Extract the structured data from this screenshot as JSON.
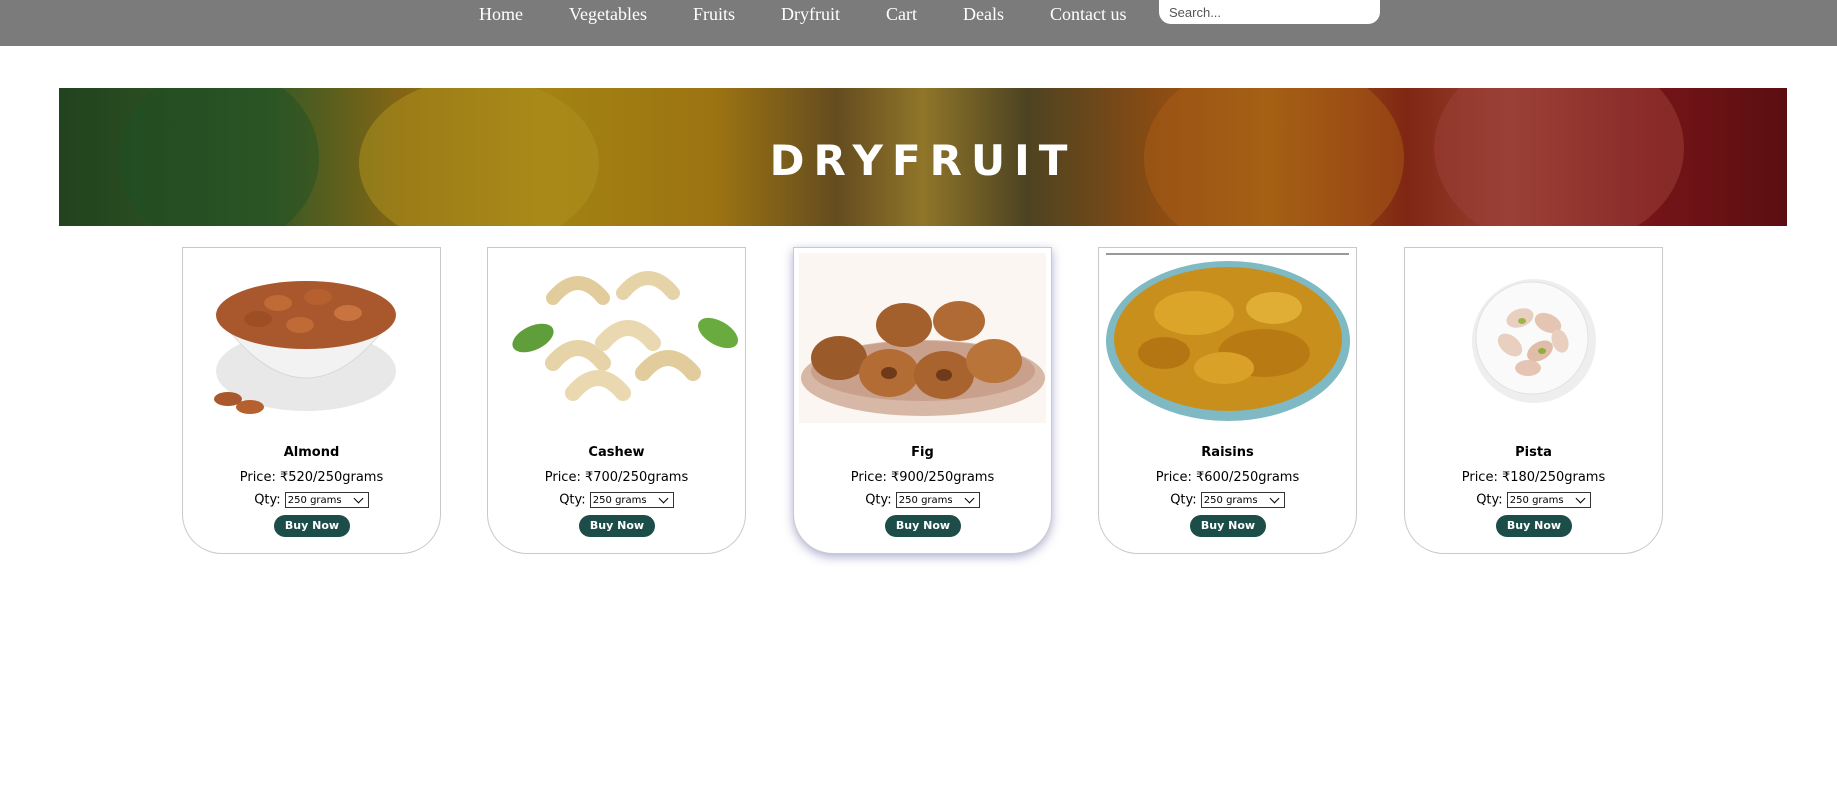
{
  "nav": {
    "items": [
      "Home",
      "Vegetables",
      "Fruits",
      "Dryfruit",
      "Cart",
      "Deals",
      "Contact us"
    ],
    "search_placeholder": "Search..."
  },
  "banner": {
    "title": "DRYFRUIT"
  },
  "products": [
    {
      "name": "Almond",
      "price": "Price: ₹520/250grams",
      "qty_label": "Qty:",
      "qty_value": "250 grams",
      "button": "Buy Now"
    },
    {
      "name": "Cashew",
      "price": "Price: ₹700/250grams",
      "qty_label": "Qty:",
      "qty_value": "250 grams",
      "button": "Buy Now"
    },
    {
      "name": "Fig",
      "price": "Price: ₹900/250grams",
      "qty_label": "Qty:",
      "qty_value": "250 grams",
      "button": "Buy Now"
    },
    {
      "name": "Raisins",
      "price": "Price: ₹600/250grams",
      "qty_label": "Qty:",
      "qty_value": "250 grams",
      "button": "Buy Now"
    },
    {
      "name": "Pista",
      "price": "Price: ₹180/250grams",
      "qty_label": "Qty:",
      "qty_value": "250 grams",
      "button": "Buy Now"
    }
  ],
  "colors": {
    "navbar": "#7b7b7b",
    "button": "#1d4d48",
    "card_border": "#c9c9c9"
  }
}
